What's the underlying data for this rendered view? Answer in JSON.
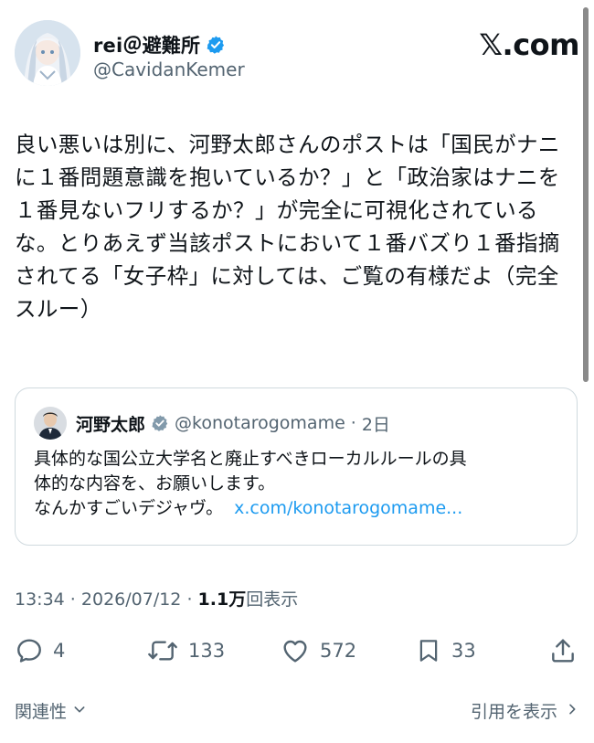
{
  "header": {
    "author_name": "rei＠避難所",
    "handle": "@CavidanKemer",
    "site_label": "𝕏.com"
  },
  "post": {
    "text": "良い悪いは別に、河野太郎さんのポストは「国民がナニに１番問題意識を抱いているか？」と「政治家はナニを１番見ないフリするか？」が完全に可視化されているな。とりあえず当該ポストにおいて１番バズり１番指摘されてる「女子枠」に対しては、ご覧の有様だよ（完全スルー）"
  },
  "quote": {
    "author_name": "河野太郎",
    "handle": "@konotarogomame",
    "separator": "·",
    "time": "2日",
    "lines": [
      "具体的な国公立大学名と廃止すべきローカルルールの具",
      "体的な内容を、お願いします。",
      "なんかすごいデジャヴ。"
    ],
    "link": "x.com/konotarogomame..."
  },
  "meta": {
    "time": "13:34",
    "sep1": " · ",
    "date": "2026/07/12",
    "sep2": " · ",
    "views": "1.1万",
    "views_label": "回表示"
  },
  "actions": {
    "replies": "4",
    "reposts": "133",
    "likes": "572",
    "bookmarks": "33"
  },
  "footer": {
    "related": "関連性",
    "view_quotes": "引用を表示"
  },
  "icons": {
    "verified": "verified-badge-icon",
    "reply": "reply-icon",
    "repost": "repost-icon",
    "like": "heart-icon",
    "bookmark": "bookmark-icon",
    "share": "share-icon",
    "chevron_down": "chevron-down-icon",
    "chevron_right": "chevron-right-icon"
  },
  "colors": {
    "text": "#0f1419",
    "secondary": "#536471",
    "link": "#1d9bf0",
    "verified": "#1d9bf0",
    "quote_verified": "#829aab",
    "border": "#cfd9de"
  }
}
